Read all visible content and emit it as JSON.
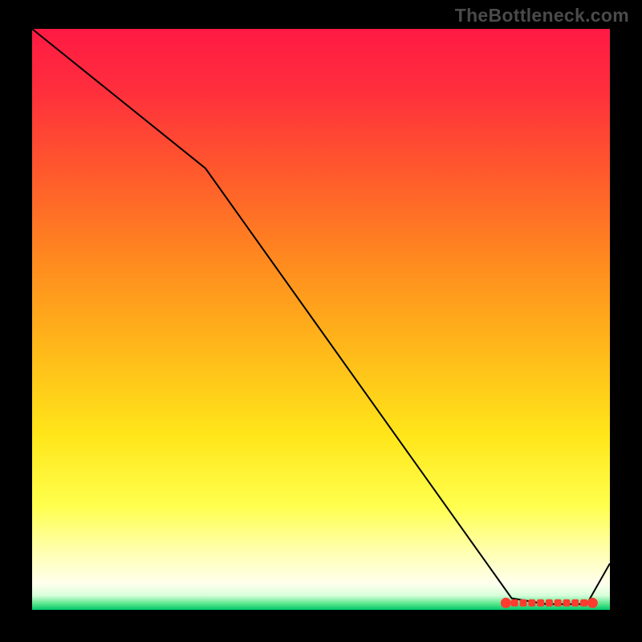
{
  "watermark": "TheBottleneck.com",
  "chart_data": {
    "type": "line",
    "title": "",
    "xlabel": "",
    "ylabel": "",
    "xlim": [
      0,
      100
    ],
    "ylim": [
      0,
      100
    ],
    "grid": false,
    "series": [
      {
        "name": "curve",
        "x": [
          0,
          30,
          83,
          89,
          96,
          100
        ],
        "y": [
          100,
          76,
          2,
          1,
          1,
          8
        ],
        "stroke": "#000000",
        "width": 2
      }
    ],
    "markers": {
      "name": "optimal-band",
      "x": [
        82,
        83.5,
        85,
        86.5,
        88,
        89.5,
        91,
        92.5,
        94,
        95.5,
        97
      ],
      "y": [
        1.2,
        1.2,
        1.2,
        1.2,
        1.2,
        1.2,
        1.2,
        1.2,
        1.2,
        1.2,
        1.2
      ],
      "color": "#ff3b2f"
    },
    "gradient_stops": [
      {
        "offset": 0.0,
        "color": "#ff1a44"
      },
      {
        "offset": 0.1,
        "color": "#ff2d3d"
      },
      {
        "offset": 0.25,
        "color": "#ff5a2c"
      },
      {
        "offset": 0.4,
        "color": "#ff8a1f"
      },
      {
        "offset": 0.55,
        "color": "#ffb81a"
      },
      {
        "offset": 0.7,
        "color": "#ffe61a"
      },
      {
        "offset": 0.82,
        "color": "#ffff4d"
      },
      {
        "offset": 0.9,
        "color": "#ffffb0"
      },
      {
        "offset": 0.955,
        "color": "#ffffee"
      },
      {
        "offset": 0.975,
        "color": "#d8ffda"
      },
      {
        "offset": 0.99,
        "color": "#55e68a"
      },
      {
        "offset": 1.0,
        "color": "#00c46a"
      }
    ]
  }
}
